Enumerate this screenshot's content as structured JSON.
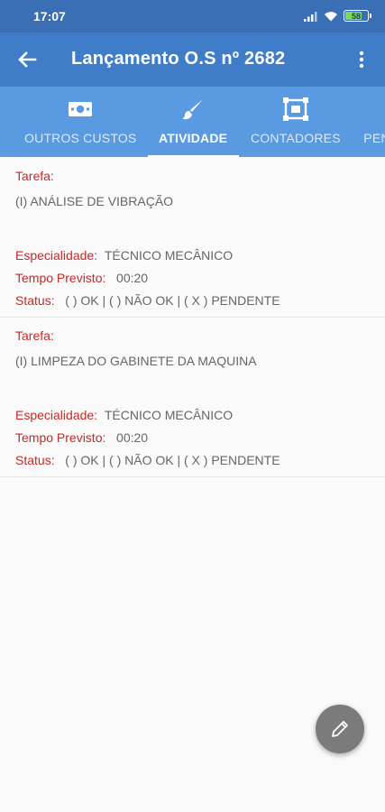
{
  "status_bar": {
    "time": "17:07",
    "battery_label": "58"
  },
  "app_bar": {
    "title": "Lançamento O.S nº 2682"
  },
  "tabs": [
    {
      "label": "OUTROS CUSTOS",
      "icon": "money-icon",
      "active": false
    },
    {
      "label": "ATIVIDADE",
      "icon": "brush-icon",
      "active": true
    },
    {
      "label": "CONTADORES",
      "icon": "counter-frame-icon",
      "active": false
    },
    {
      "label": "PEN",
      "icon": "",
      "active": false
    }
  ],
  "activities": [
    {
      "task_label": "Tarefa:",
      "task": "(I) ANÁLISE DE VIBRAÇÃO",
      "specialty_label": "Especialidade:",
      "specialty": "TÉCNICO MECÂNICO",
      "time_label": "Tempo Previsto:",
      "time": "00:20",
      "status_label": "Status:",
      "status": "(   ) OK | (   ) NÃO OK | ( X ) PENDENTE"
    },
    {
      "task_label": "Tarefa:",
      "task": "(I) LIMPEZA DO GABINETE DA MAQUINA",
      "specialty_label": "Especialidade:",
      "specialty": "TÉCNICO MECÂNICO",
      "time_label": "Tempo Previsto:",
      "time": "00:20",
      "status_label": "Status:",
      "status": "(   ) OK | (   ) NÃO OK | ( X ) PENDENTE"
    }
  ],
  "fab": {
    "icon": "pencil-icon"
  },
  "colors": {
    "status_bar": "#3a6fb5",
    "app_bar": "#3f7dc8",
    "tab_bar": "#5a9ae0",
    "label_red": "#c62828",
    "fab": "#7b7b7b"
  }
}
